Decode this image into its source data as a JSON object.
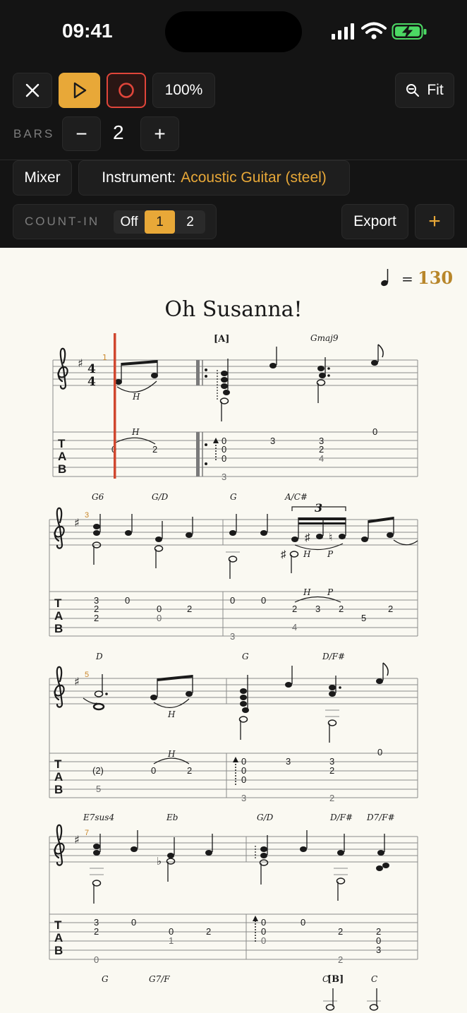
{
  "status_bar": {
    "time": "09:41",
    "icons": [
      "cellular-signal-icon",
      "wifi-icon",
      "battery-charging-icon"
    ],
    "battery_color": "#4cd964"
  },
  "toolbar": {
    "zoom": "100%",
    "fit_label": "Fit",
    "bars_label": "BARS",
    "bars_value": "2",
    "minus_label": "−",
    "plus_label": "+",
    "mixer_label": "Mixer",
    "instrument_prefix": "Instrument:",
    "instrument_name": "Acoustic Guitar (steel)",
    "countin_label": "COUNT-IN",
    "countin_options": [
      "Off",
      "1",
      "2"
    ],
    "countin_selected": "1",
    "export_label": "Export",
    "add_label": "+",
    "accent_color": "#e8a838",
    "record_color": "#e0453a"
  },
  "score": {
    "title": "Oh Susanna!",
    "tempo_value": "130",
    "tempo_equals": "=",
    "measure_numbers": [
      "1",
      "3",
      "5",
      "7"
    ],
    "rehearsal_marks": [
      "[A]",
      "[B]"
    ],
    "chords_system1": [
      "Gmaj9"
    ],
    "chords_system2": [
      "G6",
      "G/D",
      "G",
      "A/C#"
    ],
    "chords_system3": [
      "D",
      "G",
      "D/F#"
    ],
    "chords_system4": [
      "E7sus4",
      "Eb",
      "G/D",
      "D/F#",
      "D7/F#"
    ],
    "chords_system5": [
      "G",
      "G7/F",
      "C",
      "C"
    ],
    "tuplet": "3",
    "technique_h": "H",
    "technique_p": "P",
    "tab_letters": [
      "T",
      "A",
      "B"
    ]
  }
}
